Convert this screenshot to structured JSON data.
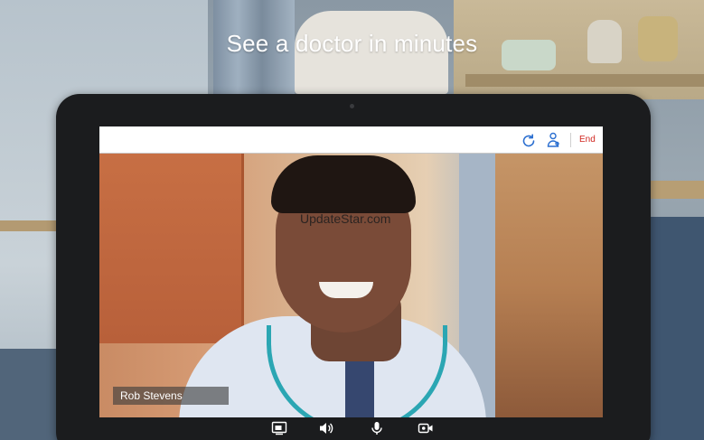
{
  "headline": "See a doctor in minutes",
  "call": {
    "end_label": "End",
    "participant_name": "Rob Stevens",
    "watermark": "UpdateStar.com"
  },
  "icons": {
    "top": [
      "refresh-icon",
      "doctor-icon"
    ],
    "bottom": [
      "screen-share-icon",
      "speaker-icon",
      "microphone-icon",
      "camera-icon"
    ]
  },
  "colors": {
    "end_red": "#d0261f",
    "icon_blue": "#2b6fd0",
    "tablet_frame": "#1b1c1e"
  }
}
